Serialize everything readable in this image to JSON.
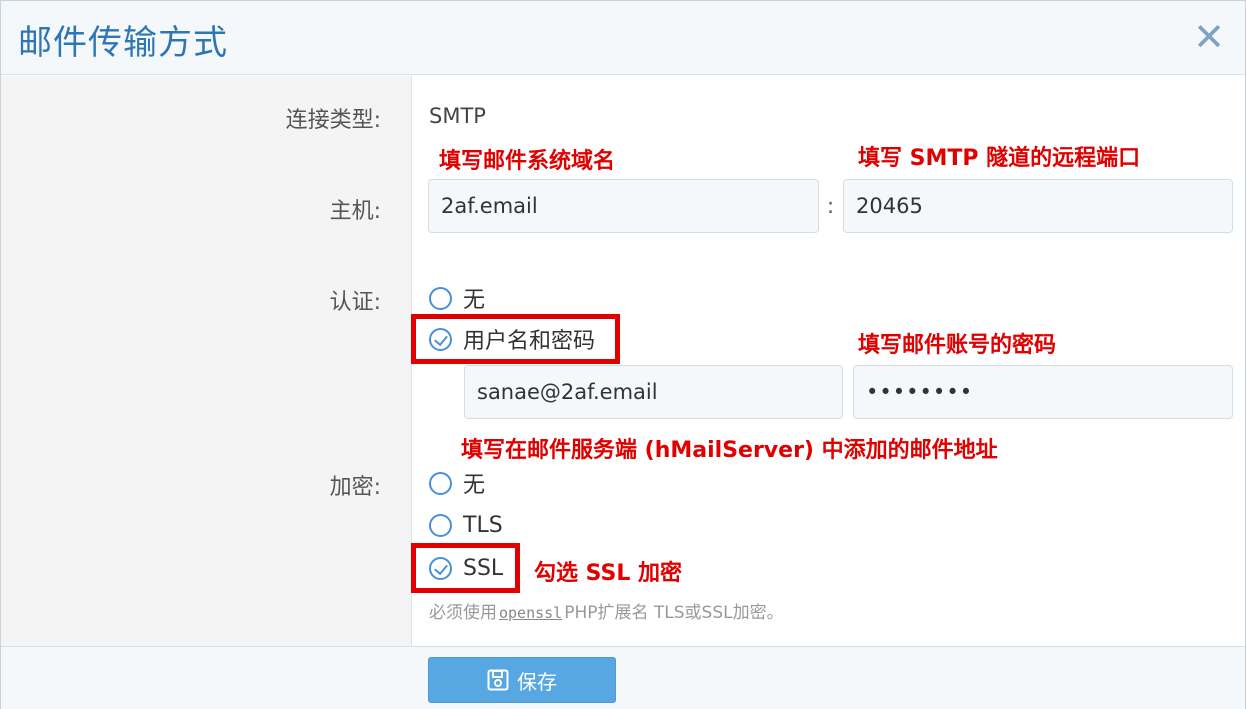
{
  "dialog": {
    "title": "邮件传输方式",
    "close_glyph": "✕"
  },
  "form": {
    "conn_type_label": "连接类型:",
    "conn_type_value": "SMTP",
    "host_label": "主机:",
    "host_value": "2af.email",
    "port_separator": ":",
    "port_value": "20465",
    "auth_label": "认证:",
    "auth_options": [
      {
        "label": "无",
        "checked": false
      },
      {
        "label": "用户名和密码",
        "checked": true
      }
    ],
    "username_value": "sanae@2af.email",
    "password_value": "••••••••",
    "encrypt_label": "加密:",
    "encrypt_options": [
      {
        "label": "无",
        "checked": false
      },
      {
        "label": "TLS",
        "checked": false
      },
      {
        "label": "SSL",
        "checked": true
      }
    ],
    "help_prefix": "必须使用",
    "help_code": "openssl",
    "help_suffix": "PHP扩展名 TLS或SSL加密。"
  },
  "annotations": {
    "host": "填写邮件系统域名",
    "port": "填写 SMTP 隧道的远程端口",
    "password": "填写邮件账号的密码",
    "username": "填写在邮件服务端 (hMailServer) 中添加的邮件地址",
    "ssl": "勾选 SSL 加密",
    "color": "#e00000"
  },
  "footer": {
    "save_label": "保存",
    "save_icon": "floppy-disk-icon"
  },
  "colors": {
    "accent": "#2e75b6",
    "button": "#56a7e2",
    "radio": "#4a90d9"
  }
}
